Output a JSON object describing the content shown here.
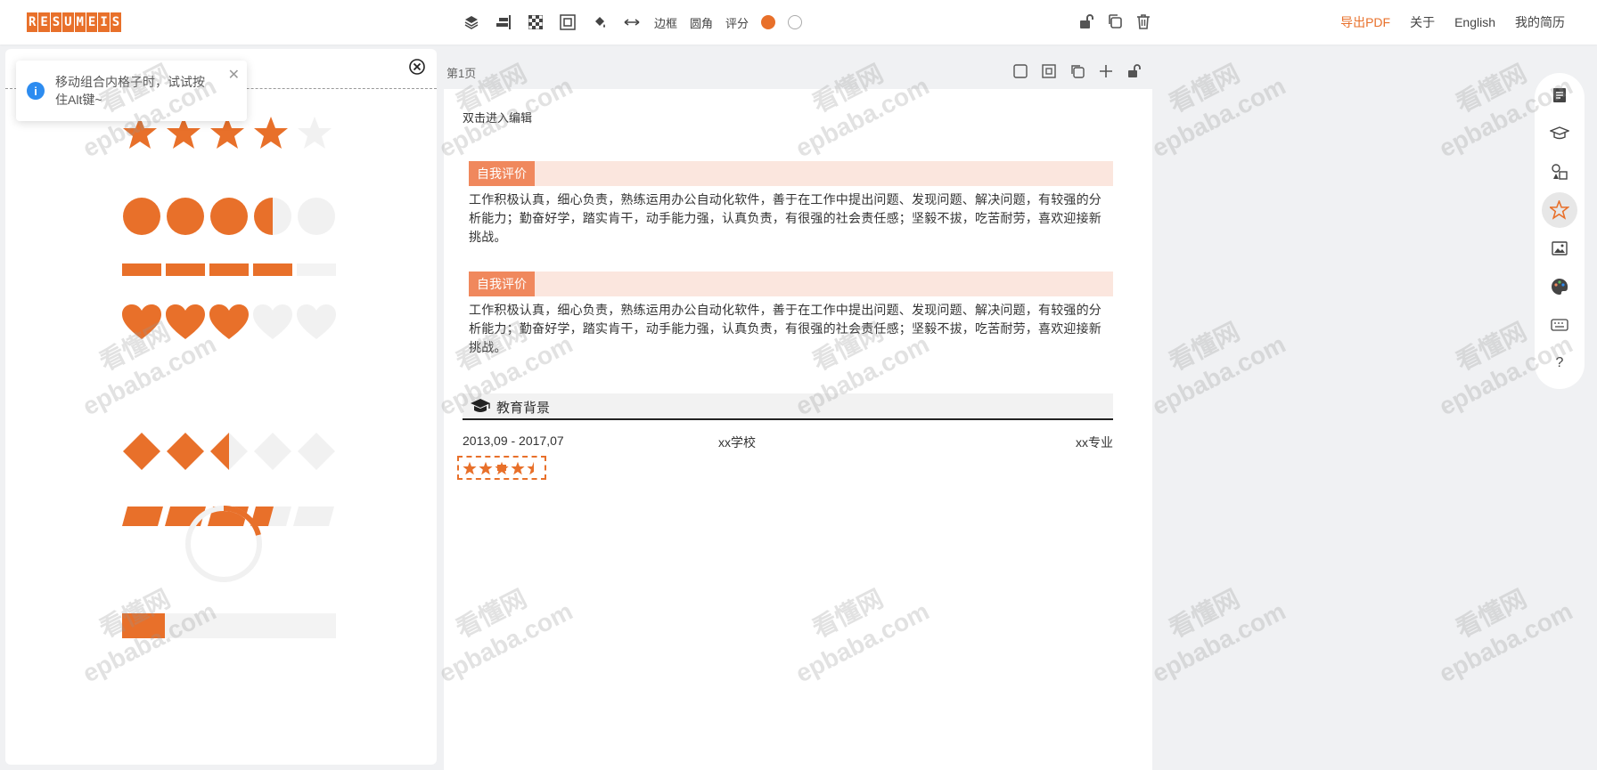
{
  "app": {
    "logo_text": "RESUMEIS"
  },
  "toolbar": {
    "border_label": "边框",
    "radius_label": "圆角",
    "rating_label": "评分"
  },
  "nav": {
    "export": "导出PDF",
    "about": "关于",
    "language": "English",
    "my_resume": "我的简历"
  },
  "toast": {
    "message": "移动组合内格子时，试试按住Alt键~"
  },
  "left_panel": {
    "ratings": [
      {
        "style": "stars",
        "value": 4.5
      },
      {
        "style": "circles",
        "value": 3.5
      },
      {
        "style": "bars",
        "value": 4
      },
      {
        "style": "hearts",
        "value": 3.5
      },
      {
        "style": "diamonds",
        "value": 2.5
      },
      {
        "style": "slanted-bars",
        "value": 3.5
      },
      {
        "style": "ring",
        "value": 0.3
      },
      {
        "style": "progress",
        "value": 0.2
      }
    ]
  },
  "page": {
    "label": "第1页"
  },
  "resume": {
    "edit_hint": "双击进入编辑",
    "sections": [
      {
        "tag": "自我评价",
        "text": "工作积极认真，细心负责，熟练运用办公自动化软件，善于在工作中提出问题、发现问题、解决问题，有较强的分析能力；勤奋好学，踏实肯干，动手能力强，认真负责，有很强的社会责任感；坚毅不拔，吃苦耐劳，喜欢迎接新挑战。"
      },
      {
        "tag": "自我评价",
        "text": "工作积极认真，细心负责，熟练运用办公自动化软件，善于在工作中提出问题、发现问题、解决问题，有较强的分析能力；勤奋好学，踏实肯干，动手能力强，认真负责，有很强的社会责任感；坚毅不拔，吃苦耐劳，喜欢迎接新挑战。"
      }
    ],
    "education": {
      "title": "教育背景",
      "period": "2013,09 - 2017,07",
      "school": "xx学校",
      "major": "xx专业"
    }
  },
  "watermark": {
    "line1": "看懂网",
    "line2": "epbaba.com"
  },
  "colors": {
    "accent": "#e8702a",
    "section_bg": "#fbe6de",
    "tag_bg": "#f0885d"
  }
}
